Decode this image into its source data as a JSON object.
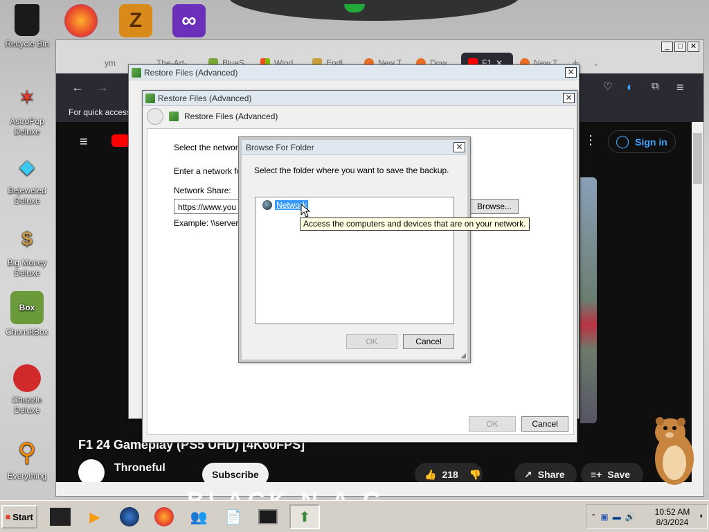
{
  "desktop": {
    "icons": [
      {
        "label": "Recycle Bin"
      },
      {
        "label": "AstroPop Deluxe"
      },
      {
        "label": "Bejeweled Deluxe"
      },
      {
        "label": "Big Money Deluxe"
      },
      {
        "label": "ChomikBox"
      },
      {
        "label": "Chuzzle Deluxe"
      },
      {
        "label": "Everything"
      }
    ]
  },
  "browser": {
    "tabs": [
      {
        "label": "ym"
      },
      {
        "label": "The-Art-"
      },
      {
        "label": "BlueS"
      },
      {
        "label": "Wind"
      },
      {
        "label": "Endl"
      },
      {
        "label": "New T"
      },
      {
        "label": "Dow"
      },
      {
        "label": "F1",
        "active": true
      },
      {
        "label": "New T"
      }
    ],
    "new_tab": "+",
    "bookmarks_text": "For quick access",
    "youtube": {
      "sign_in": "Sign in",
      "video_title": "F1 24 Gameplay (PS5 UHD) [4K60FPS]",
      "channel": "Throneful",
      "subscribe": "Subscribe",
      "likes": "218",
      "share": "Share",
      "save": "Save",
      "caption_overlay": "BLACK N A G"
    }
  },
  "dialog_outer": {
    "title": "Restore Files (Advanced)"
  },
  "dialog_inner": {
    "title": "Restore Files (Advanced)",
    "header": "Restore Files (Advanced)",
    "select_text": "Select the network",
    "enter_text": "Enter a network fo",
    "network_share_label": "Network Share:",
    "network_share_value": "https://www.you",
    "browse_button": "Browse...",
    "example_text": "Example: \\\\server\\",
    "ok_button": "OK",
    "cancel_button": "Cancel"
  },
  "browse_folder": {
    "title": "Browse For Folder",
    "instruction": "Select the folder where you want to save the backup.",
    "tree_item": "Network",
    "tooltip": "Access the computers and devices that are on your network.",
    "ok_button": "OK",
    "cancel_button": "Cancel"
  },
  "taskbar": {
    "start": "Start",
    "time": "10:52 AM",
    "date": "8/3/2024"
  }
}
